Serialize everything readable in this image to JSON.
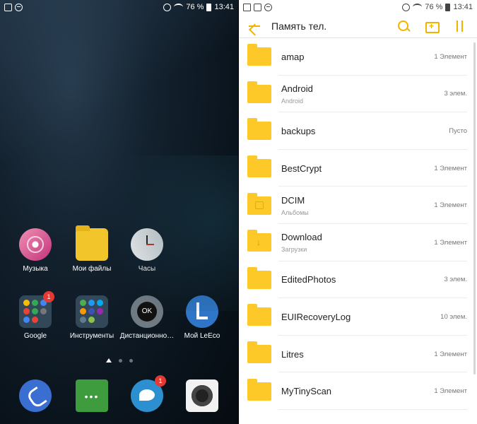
{
  "left_status": {
    "battery": "76 %",
    "time": "13:41"
  },
  "right_status": {
    "battery": "76 %",
    "time": "13:41"
  },
  "home": {
    "apps": [
      {
        "label": "Музыка"
      },
      {
        "label": "Мои файлы"
      },
      {
        "label": "Часы"
      },
      {
        "label": "Google",
        "badge": "1"
      },
      {
        "label": "Инструменты"
      },
      {
        "label": "Дистанционно…"
      },
      {
        "label": "Мой LeEco"
      }
    ],
    "dock": [
      {
        "name": "phone"
      },
      {
        "name": "messages"
      },
      {
        "name": "kiwi-browser",
        "badge": "1"
      },
      {
        "name": "camera"
      }
    ],
    "remote_ok": "OK"
  },
  "files": {
    "title": "Память тел.",
    "items": [
      {
        "name": "amap",
        "sub": "",
        "count": "1 Элемент"
      },
      {
        "name": "Android",
        "sub": "Android",
        "count": "3 элем."
      },
      {
        "name": "backups",
        "sub": "",
        "count": "Пусто"
      },
      {
        "name": "BestCrypt",
        "sub": "",
        "count": "1 Элемент"
      },
      {
        "name": "DCIM",
        "sub": "Альбомы",
        "count": "1 Элемент"
      },
      {
        "name": "Download",
        "sub": "Загрузки",
        "count": "1 Элемент"
      },
      {
        "name": "EditedPhotos",
        "sub": "",
        "count": "3 элем."
      },
      {
        "name": "EUIRecoveryLog",
        "sub": "",
        "count": "10 элем."
      },
      {
        "name": "Litres",
        "sub": "",
        "count": "1 Элемент"
      },
      {
        "name": "MyTinyScan",
        "sub": "",
        "count": "1 Элемент"
      }
    ]
  }
}
